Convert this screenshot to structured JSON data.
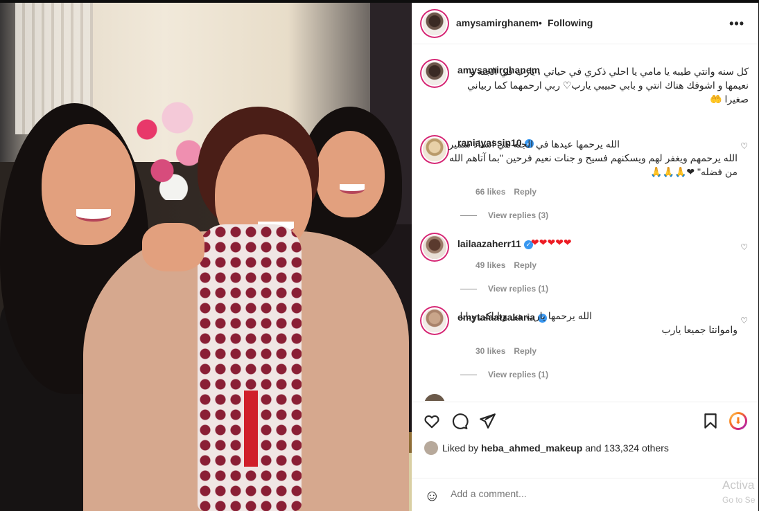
{
  "post": {
    "username": "amysamirghanem",
    "separator": "•",
    "follow_status": "Following",
    "more": "•••"
  },
  "caption": {
    "username": "amysamirghanem",
    "text": "كل سنه وانتي طيبه يا مامي يا احلي ذكري في حياتي ، يارب في الجنه و نعيمها و اشوفك هناك انتي و بابي حبيبي يارب♡ ربي ارحمهما كما ربياني صغيرا 🤲"
  },
  "comments": [
    {
      "username": "raniayassin10",
      "verified": true,
      "text": "الله يرحمها عيدها في الجنه هي استاذ سمير الله يرحمهم ويغفر لهم ويسكنهم فسيح و جنات نعيم فرحين \"بما آتاهم الله من فضله\" ❤🙏🙏🙏",
      "likes": "66 likes",
      "reply": "Reply",
      "view_replies": "View replies (3)"
    },
    {
      "username": "lailaazaherr11",
      "verified": true,
      "text": "❤❤❤❤❤",
      "likes": "49 likes",
      "reply": "Reply",
      "view_replies": "View replies (1)"
    },
    {
      "username": "emytalaatzakaria",
      "verified": true,
      "text": "الله يرحمها يارب هى وباباكى وبابا واموانتا جميعا يارب",
      "likes": "30 likes",
      "reply": "Reply",
      "view_replies": "View replies (1)"
    }
  ],
  "likes": {
    "prefix": "Liked by",
    "user": "heba_ahmed_makeup",
    "suffix": "and 133,324 others"
  },
  "add_comment": {
    "placeholder": "Add a comment..."
  },
  "watermark": {
    "line1": "Activa",
    "line2": "Go to Se"
  },
  "colors": {
    "story_ring": "#d62976",
    "verified": "#3897f0",
    "heart": "#ed1c24"
  },
  "icons": [
    "heart-icon",
    "comment-icon",
    "share-icon",
    "bookmark-icon",
    "smiley-icon",
    "more-icon"
  ]
}
